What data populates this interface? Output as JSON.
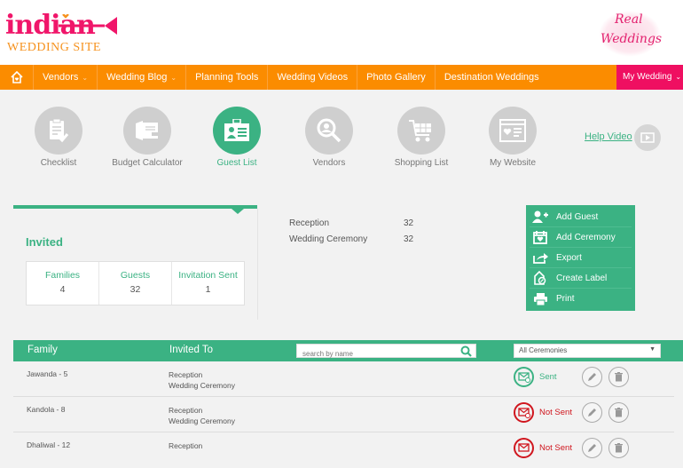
{
  "header": {
    "logo_brand": "indian",
    "logo_sub": "WEDDING SITE",
    "real_weddings_line1": "Real",
    "real_weddings_line2": "Weddings"
  },
  "nav": {
    "home_icon": "home-icon",
    "items": [
      {
        "label": "Vendors",
        "has_dropdown": true
      },
      {
        "label": "Wedding Blog",
        "has_dropdown": true
      },
      {
        "label": "Planning Tools",
        "has_dropdown": false
      },
      {
        "label": "Wedding Videos",
        "has_dropdown": false
      },
      {
        "label": "Photo Gallery",
        "has_dropdown": false
      },
      {
        "label": "Destination Weddings",
        "has_dropdown": false
      }
    ],
    "my_wedding": "My Wedding",
    "chevron": "⌄",
    "colors": {
      "bar": "#fb8c00",
      "my_wedding": "#ef0f61"
    }
  },
  "tools": [
    {
      "label": "Checklist",
      "icon": "clipboard-check-icon",
      "active": false
    },
    {
      "label": "Budget Calculator",
      "icon": "wallet-icon",
      "active": false
    },
    {
      "label": "Guest List",
      "icon": "id-card-icon",
      "active": true
    },
    {
      "label": "Vendors",
      "icon": "search-person-icon",
      "active": false
    },
    {
      "label": "Shopping List",
      "icon": "cart-icon",
      "active": false
    },
    {
      "label": "My Website",
      "icon": "website-heart-icon",
      "active": false
    }
  ],
  "help": {
    "label": "Help Video",
    "icon": "play-icon"
  },
  "invited": {
    "title": "Invited",
    "stats": [
      {
        "label": "Families",
        "value": "4"
      },
      {
        "label": "Guests",
        "value": "32"
      },
      {
        "label": "Invitation Sent",
        "value": "1"
      }
    ]
  },
  "ceremonies": [
    {
      "name": "Reception",
      "count": "32"
    },
    {
      "name": "Wedding Ceremony",
      "count": "32"
    }
  ],
  "actions": [
    {
      "label": "Add Guest",
      "icon": "add-user-icon"
    },
    {
      "label": "Add Ceremony",
      "icon": "calendar-heart-icon"
    },
    {
      "label": "Export",
      "icon": "export-icon"
    },
    {
      "label": "Create Label",
      "icon": "label-tag-icon"
    },
    {
      "label": "Print",
      "icon": "printer-icon"
    }
  ],
  "table": {
    "headers": {
      "family": "Family",
      "invited_to": "Invited To"
    },
    "search_placeholder": "search by name",
    "filter_selected": "All Ceremonies",
    "filter_arrow": "▼",
    "rows": [
      {
        "family": "Jawanda - 5",
        "invited": [
          "Reception",
          "Wedding Ceremony"
        ],
        "status": "Sent"
      },
      {
        "family": "Kandola - 8",
        "invited": [
          "Reception",
          "Wedding Ceremony"
        ],
        "status": "Not Sent"
      },
      {
        "family": "Dhaliwal - 12",
        "invited": [
          "Reception"
        ],
        "status": "Not Sent"
      }
    ]
  },
  "colors": {
    "accent_green": "#3bb283",
    "sent_green": "#3bb283",
    "not_sent_red": "#d0161e",
    "logo_pink": "#f0166a",
    "logo_orange": "#f6921e"
  }
}
